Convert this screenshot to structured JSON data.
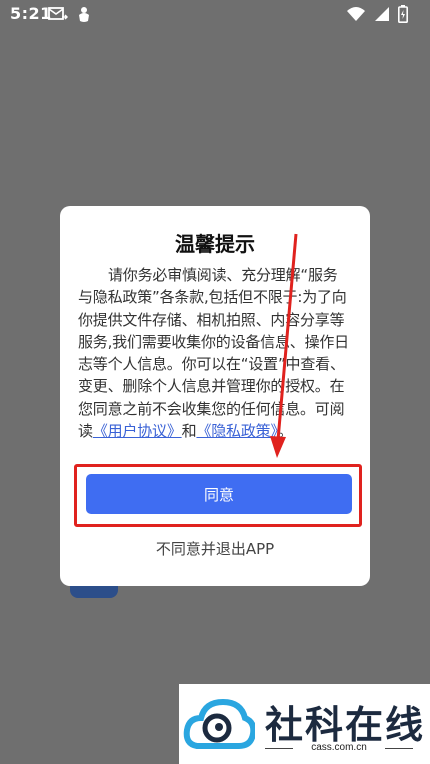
{
  "status_bar": {
    "time": "5:21",
    "left_icons": [
      "mail-forward-icon",
      "bug-icon"
    ],
    "right_icons": [
      "wifi-icon",
      "signal-icon",
      "battery-icon"
    ]
  },
  "dialog": {
    "title": "温馨提示",
    "body_text": "请你务必审慎阅读、充分理解“服务与隐私政策”各条款,包括但不限于:为了向你提供文件存储、相机拍照、内容分享等服务,我们需要收集你的设备信息、操作日志等个人信息。你可以在“设置”中查看、变更、删除个人信息并管理你的授权。在您同意之前不会收集您的任何信息。可阅读",
    "user_agreement_link": "《用户协议》",
    "connector": "和",
    "privacy_policy_link": "《隐私政策》",
    "end_punct": "。",
    "agree_label": "同意",
    "disagree_label": "不同意并退出APP"
  },
  "annotation": {
    "highlight_color": "#e0221e"
  },
  "watermark": {
    "brand": "社科在线",
    "url": "cass.com.cn"
  },
  "colors": {
    "accent": "#3f6df2",
    "link": "#3a62d6",
    "overlay": "#6f6f6f"
  }
}
